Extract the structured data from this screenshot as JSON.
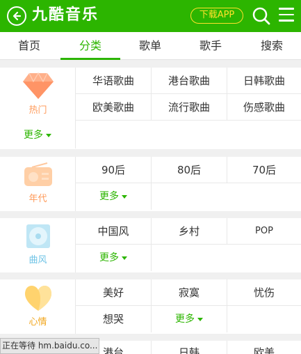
{
  "header": {
    "logo": "九酷音乐",
    "download_label": "下载APP",
    "bg_color": "#2cb500",
    "accent_color": "#ffe12a"
  },
  "tabs": [
    {
      "label": "首页",
      "active": false
    },
    {
      "label": "分类",
      "active": true
    },
    {
      "label": "歌单",
      "active": false
    },
    {
      "label": "歌手",
      "active": false
    },
    {
      "label": "搜索",
      "active": false
    }
  ],
  "sections": [
    {
      "label": "热门",
      "icon": "diamond-icon",
      "items": [
        "华语歌曲",
        "港台歌曲",
        "日韩歌曲",
        "欧美歌曲",
        "流行歌曲",
        "伤感歌曲"
      ],
      "more": "更多"
    },
    {
      "label": "年代",
      "icon": "radio-icon",
      "items": [
        "90后",
        "80后",
        "70后"
      ],
      "more": "更多"
    },
    {
      "label": "曲风",
      "icon": "disc-icon",
      "items": [
        "中国风",
        "乡村",
        "POP"
      ],
      "more": "更多"
    },
    {
      "label": "心情",
      "icon": "heart-icon",
      "items": [
        "美好",
        "寂寞",
        "忧伤",
        "想哭"
      ],
      "more": "更多"
    },
    {
      "label": "",
      "icon": "",
      "items": [
        "港台",
        "日韩",
        "欧美"
      ],
      "more": ""
    }
  ],
  "status_bar": "正在等待 hm.baidu.co..."
}
